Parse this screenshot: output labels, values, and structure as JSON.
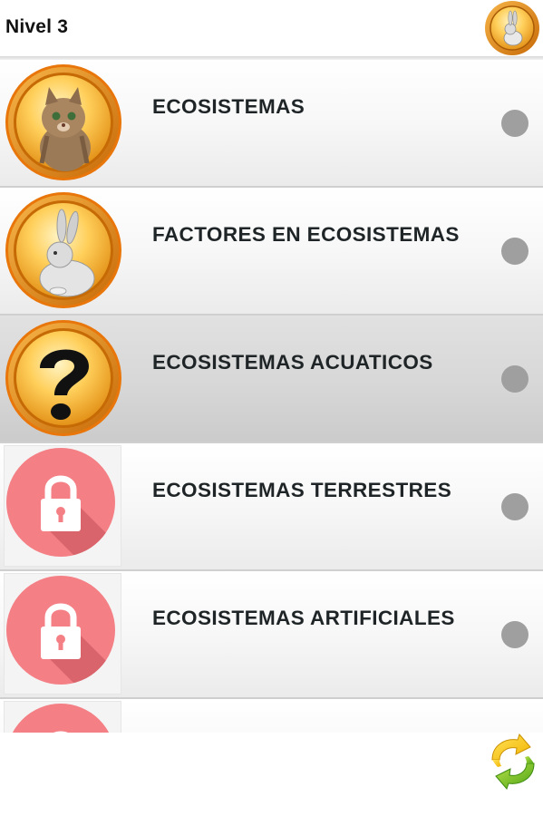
{
  "header": {
    "title": "Nivel 3",
    "avatar_icon": "rabbit-medal-icon"
  },
  "items": [
    {
      "label": "ECOSISTEMAS",
      "icon": "kitten-medal-icon",
      "state": "completed"
    },
    {
      "label": "FACTORES EN ECOSISTEMAS",
      "icon": "rabbit-medal-icon",
      "state": "completed"
    },
    {
      "label": "ECOSISTEMAS ACUATICOS",
      "icon": "question-medal-icon",
      "state": "current"
    },
    {
      "label": "ECOSISTEMAS TERRESTRES",
      "icon": "lock-icon",
      "state": "locked"
    },
    {
      "label": "ECOSISTEMAS ARTIFICIALES",
      "icon": "lock-icon",
      "state": "locked"
    },
    {
      "label": "",
      "icon": "lock-icon",
      "state": "locked"
    }
  ],
  "footer": {
    "refresh_icon": "refresh-icon"
  },
  "colors": {
    "medal_gold": "#f5a623",
    "lock_pink": "#f47f85",
    "status_dot": "#9f9f9f"
  }
}
